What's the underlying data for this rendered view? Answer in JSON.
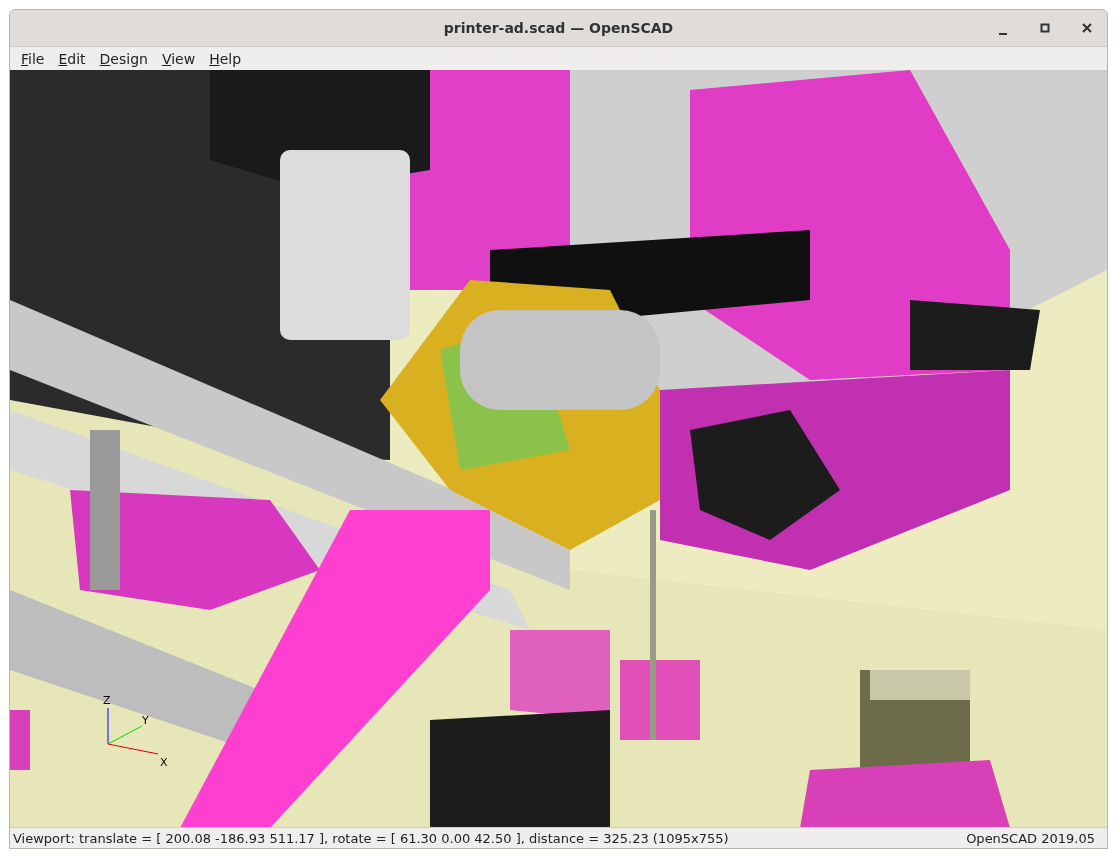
{
  "window": {
    "title": "printer-ad.scad — OpenSCAD"
  },
  "menu": [
    {
      "label": "File"
    },
    {
      "label": "Edit"
    },
    {
      "label": "Design"
    },
    {
      "label": "View"
    },
    {
      "label": "Help"
    }
  ],
  "viewport": {
    "axes": {
      "x": "X",
      "y": "Y",
      "z": "Z"
    }
  },
  "status_bar": {
    "viewport_info": "Viewport: translate = [ 200.08 -186.93 511.17 ], rotate = [ 61.30 0.00 42.50 ], distance = 325.23 (1095x755)",
    "version": "OpenSCAD 2019.05"
  }
}
